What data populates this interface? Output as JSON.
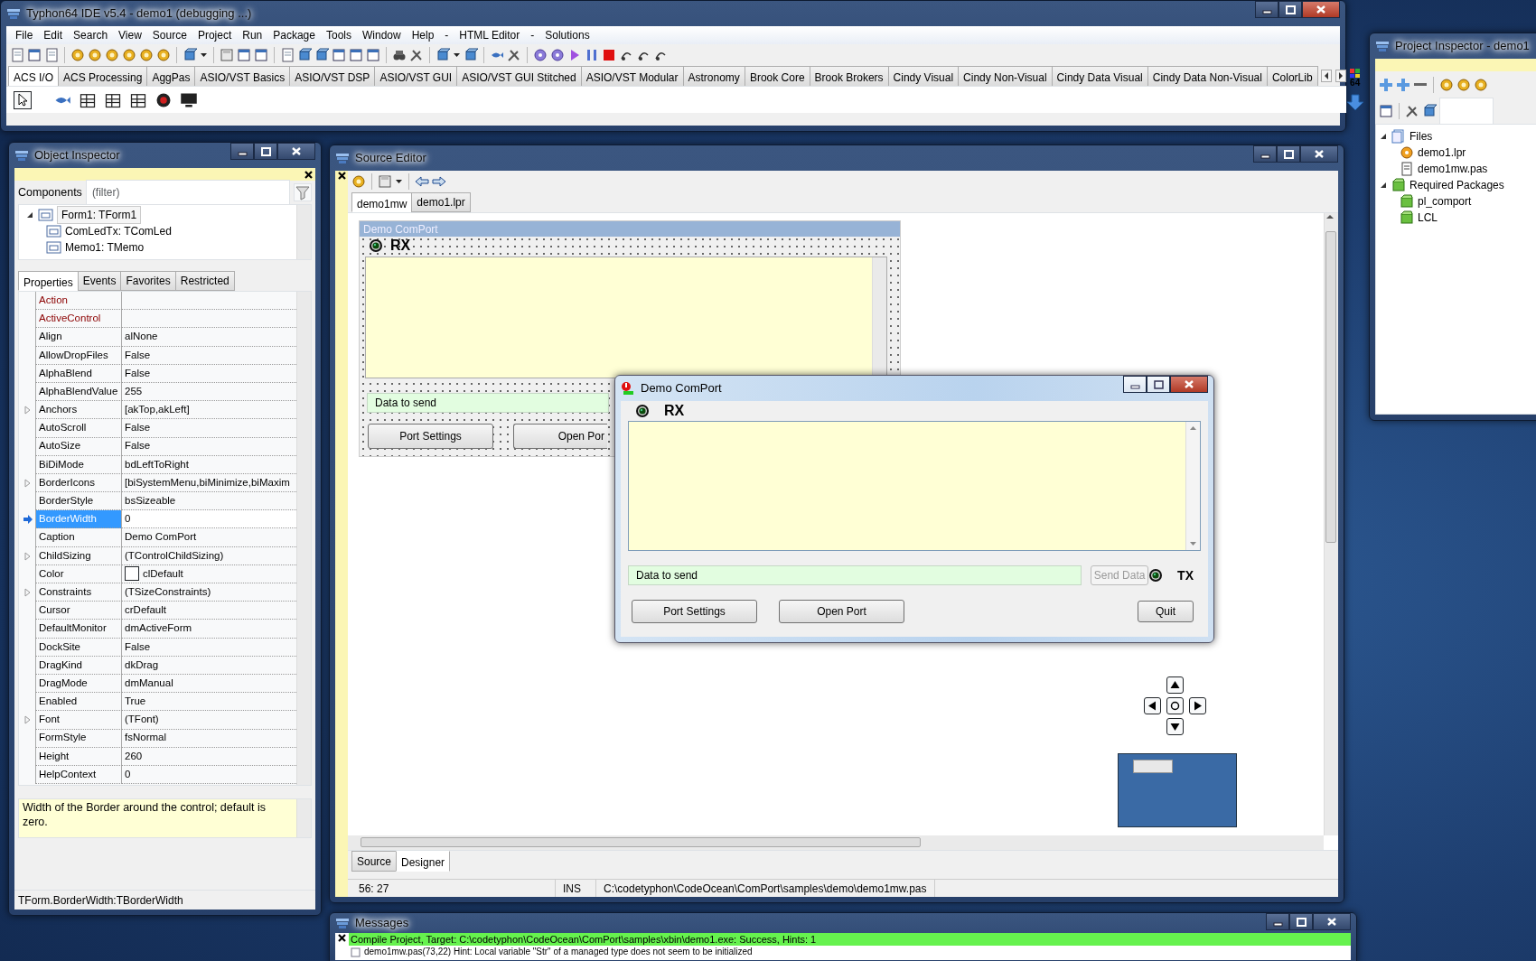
{
  "ide": {
    "title": "Typhon64 IDE v5.4 - demo1 (debugging ...)",
    "menu": [
      "File",
      "Edit",
      "Search",
      "View",
      "Source",
      "Project",
      "Run",
      "Package",
      "Tools",
      "Window",
      "Help",
      "-",
      "HTML Editor",
      "-",
      "Solutions"
    ],
    "palette_tabs": [
      {
        "label": "ACS I/O",
        "selected": true
      },
      {
        "label": "ACS Processing",
        "selected": false
      },
      {
        "label": "AggPas",
        "selected": false
      },
      {
        "label": "ASIO/VST Basics",
        "selected": false
      },
      {
        "label": "ASIO/VST DSP",
        "selected": false
      },
      {
        "label": "ASIO/VST GUI",
        "selected": false
      },
      {
        "label": "ASIO/VST GUI Stitched",
        "selected": false
      },
      {
        "label": "ASIO/VST Modular",
        "selected": false
      },
      {
        "label": "Astronomy",
        "selected": false
      },
      {
        "label": "Brook Core",
        "selected": false
      },
      {
        "label": "Brook Brokers",
        "selected": false
      },
      {
        "label": "Cindy Visual",
        "selected": false
      },
      {
        "label": "Cindy Non-Visual",
        "selected": false
      },
      {
        "label": "Cindy Data Visual",
        "selected": false
      },
      {
        "label": "Cindy Data Non-Visual",
        "selected": false
      },
      {
        "label": "ColorLib",
        "selected": false
      }
    ],
    "palette_badge": "64"
  },
  "object_inspector": {
    "title": "Object Inspector",
    "filter_label": "Components",
    "filter_placeholder": "(filter)",
    "tree": [
      {
        "label": "Form1: TForm1",
        "expanded": true,
        "selected": true,
        "children": [
          {
            "label": "ComLedTx: TComLed",
            "selected": false
          },
          {
            "label": "Memo1: TMemo",
            "selected": false
          }
        ]
      }
    ],
    "tabs": [
      {
        "label": "Properties",
        "selected": true
      },
      {
        "label": "Events",
        "selected": false
      },
      {
        "label": "Favorites",
        "selected": false
      },
      {
        "label": "Restricted",
        "selected": false
      }
    ],
    "properties": [
      {
        "name": "Action",
        "kind": "reference",
        "expandable": false,
        "selected": false
      },
      {
        "name": "ActiveControl",
        "kind": "reference",
        "expandable": false,
        "selected": false
      },
      {
        "name": "Align",
        "value": "alNone",
        "kind": "plain",
        "expandable": false,
        "selected": false
      },
      {
        "name": "AllowDropFiles",
        "value": "False",
        "kind": "plain",
        "expandable": false,
        "selected": false
      },
      {
        "name": "AlphaBlend",
        "value": "False",
        "kind": "plain",
        "expandable": false,
        "selected": false
      },
      {
        "name": "AlphaBlendValue",
        "value": "255",
        "kind": "plain",
        "expandable": false,
        "selected": false
      },
      {
        "name": "Anchors",
        "value": "[akTop,akLeft]",
        "kind": "plain",
        "expandable": true,
        "selected": false
      },
      {
        "name": "AutoScroll",
        "value": "False",
        "kind": "plain",
        "expandable": false,
        "selected": false
      },
      {
        "name": "AutoSize",
        "value": "False",
        "kind": "plain",
        "expandable": false,
        "selected": false
      },
      {
        "name": "BiDiMode",
        "value": "bdLeftToRight",
        "kind": "plain",
        "expandable": false,
        "selected": false
      },
      {
        "name": "BorderIcons",
        "value": "[biSystemMenu,biMinimize,biMaxim",
        "kind": "plain",
        "expandable": true,
        "selected": false
      },
      {
        "name": "BorderStyle",
        "value": "bsSizeable",
        "kind": "plain",
        "expandable": false,
        "selected": false
      },
      {
        "name": "BorderWidth",
        "value": "0",
        "kind": "plain",
        "expandable": false,
        "selected": true
      },
      {
        "name": "Caption",
        "value": "Demo ComPort",
        "kind": "plain",
        "expandable": false,
        "selected": false
      },
      {
        "name": "ChildSizing",
        "value": "(TControlChildSizing)",
        "kind": "plain",
        "expandable": true,
        "selected": false
      },
      {
        "name": "Color",
        "value": "clDefault",
        "kind": "color",
        "expandable": false,
        "selected": false
      },
      {
        "name": "Constraints",
        "value": "(TSizeConstraints)",
        "kind": "plain",
        "expandable": true,
        "selected": false
      },
      {
        "name": "Cursor",
        "value": "crDefault",
        "kind": "plain",
        "expandable": false,
        "selected": false
      },
      {
        "name": "DefaultMonitor",
        "value": "dmActiveForm",
        "kind": "plain",
        "expandable": false,
        "selected": false
      },
      {
        "name": "DockSite",
        "value": "False",
        "kind": "plain",
        "expandable": false,
        "selected": false
      },
      {
        "name": "DragKind",
        "value": "dkDrag",
        "kind": "plain",
        "expandable": false,
        "selected": false
      },
      {
        "name": "DragMode",
        "value": "dmManual",
        "kind": "plain",
        "expandable": false,
        "selected": false
      },
      {
        "name": "Enabled",
        "value": "True",
        "kind": "plain",
        "expandable": false,
        "selected": false
      },
      {
        "name": "Font",
        "value": "(TFont)",
        "kind": "plain",
        "expandable": true,
        "selected": false
      },
      {
        "name": "FormStyle",
        "value": "fsNormal",
        "kind": "plain",
        "expandable": false,
        "selected": false
      },
      {
        "name": "Height",
        "value": "260",
        "kind": "plain",
        "expandable": false,
        "selected": false
      },
      {
        "name": "HelpContext",
        "value": "0",
        "kind": "plain",
        "expandable": false,
        "selected": false
      }
    ],
    "help": "Width of the Border around the control; default is zero.",
    "status": "TForm.BorderWidth:TBorderWidth"
  },
  "source_editor": {
    "title": "Source Editor",
    "tabs": [
      {
        "label": "demo1mw",
        "selected": true
      },
      {
        "label": "demo1.lpr",
        "selected": false
      }
    ],
    "form": {
      "caption": "Demo ComPort",
      "rx": "RX",
      "data": "Data to send",
      "buttons": [
        "Port Settings",
        "Open Por"
      ]
    },
    "bottom_tabs": [
      {
        "label": "Source",
        "selected": false
      },
      {
        "label": "Designer",
        "selected": true
      }
    ],
    "status": [
      "56: 27",
      "INS",
      "C:\\codetyphon\\CodeOcean\\ComPort\\samples\\demo\\demo1mw.pas"
    ]
  },
  "messages": {
    "title": "Messages",
    "lines": [
      {
        "text": "Compile Project, Target: C:\\codetyphon\\CodeOcean\\ComPort\\samples\\xbin\\demo1.exe: Success, Hints: 1",
        "kind": "success"
      },
      {
        "text": "demo1mw.pas(73,22) Hint: Local variable \"Str\" of a managed type does not seem to be initialized",
        "kind": "hint"
      }
    ]
  },
  "project_inspector": {
    "title": "Project Inspector - demo1",
    "tree": [
      {
        "label": "Files",
        "kind": "folder",
        "expanded": true,
        "children": [
          {
            "label": "demo1.lpr",
            "kind": "program"
          },
          {
            "label": "demo1mw.pas",
            "kind": "unit"
          }
        ]
      },
      {
        "label": "Required Packages",
        "kind": "packages",
        "expanded": true,
        "children": [
          {
            "label": "pl_comport",
            "kind": "package"
          },
          {
            "label": "LCL",
            "kind": "package"
          }
        ]
      }
    ]
  },
  "dialog": {
    "title": "Demo ComPort",
    "rx": "RX",
    "data": "Data to send",
    "send_button": {
      "label": "Send Data",
      "disabled": true
    },
    "tx": "TX",
    "buttons": [
      "Port Settings",
      "Open Port",
      "Quit"
    ]
  }
}
